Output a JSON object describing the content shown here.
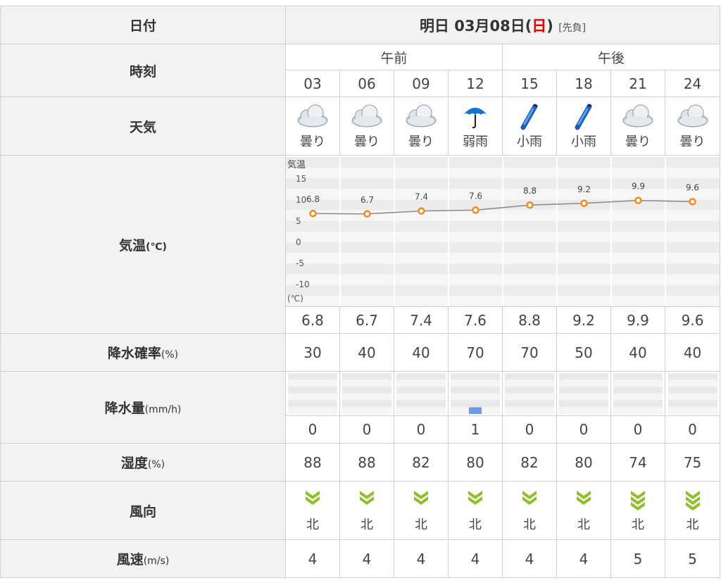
{
  "header": {
    "date_label": "日付",
    "date_prefix": "明日 03月08日(",
    "day_of_week": "日",
    "date_suffix": ")",
    "rokuyo": "[先負]"
  },
  "labels": {
    "time": "時刻",
    "weather": "天気",
    "temp": "気温",
    "temp_unit": "(℃)",
    "precip_prob": "降水確率",
    "precip_prob_unit": "(%)",
    "precip_amount": "降水量",
    "precip_amount_unit": "(mm/h)",
    "humidity": "湿度",
    "humidity_unit": "(%)",
    "wind_dir": "風向",
    "wind_speed": "風速",
    "wind_speed_unit": "(m/s)"
  },
  "periods": {
    "am": "午前",
    "pm": "午後"
  },
  "hours": [
    "03",
    "06",
    "09",
    "12",
    "15",
    "18",
    "21",
    "24"
  ],
  "weather": [
    {
      "icon": "cloud-icon",
      "label": "曇り"
    },
    {
      "icon": "cloud-icon",
      "label": "曇り"
    },
    {
      "icon": "cloud-icon",
      "label": "曇り"
    },
    {
      "icon": "umbrella-icon",
      "label": "弱雨"
    },
    {
      "icon": "light-rain-icon",
      "label": "小雨"
    },
    {
      "icon": "light-rain-icon",
      "label": "小雨"
    },
    {
      "icon": "cloud-icon",
      "label": "曇り"
    },
    {
      "icon": "cloud-icon",
      "label": "曇り"
    }
  ],
  "temperatures": [
    "6.8",
    "6.7",
    "7.4",
    "7.6",
    "8.8",
    "9.2",
    "9.9",
    "9.6"
  ],
  "precip_prob": [
    "30",
    "40",
    "40",
    "70",
    "70",
    "50",
    "40",
    "40"
  ],
  "precip_amount": [
    "0",
    "0",
    "0",
    "1",
    "0",
    "0",
    "0",
    "0"
  ],
  "humidity": [
    "88",
    "88",
    "82",
    "80",
    "82",
    "80",
    "74",
    "75"
  ],
  "wind_direction": [
    "北",
    "北",
    "北",
    "北",
    "北",
    "北",
    "北",
    "北"
  ],
  "wind_speed": [
    "4",
    "4",
    "4",
    "4",
    "4",
    "4",
    "5",
    "5"
  ],
  "chart_data": {
    "type": "line",
    "title": "気温",
    "ylabel": "(℃)",
    "categories": [
      "03",
      "06",
      "09",
      "12",
      "15",
      "18",
      "21",
      "24"
    ],
    "ylim": [
      -10,
      15
    ],
    "yticks": [
      "15",
      "10",
      "5",
      "0",
      "-5",
      "-10"
    ],
    "point_labels": [
      "6.8",
      "6.7",
      "7.4",
      "7.6",
      "8.8",
      "9.2",
      "9.9",
      "9.6"
    ],
    "series": [
      {
        "values": [
          6.8,
          6.7,
          7.4,
          7.6,
          8.8,
          9.2,
          9.9,
          9.6
        ]
      }
    ],
    "colors": {
      "line": "#888888",
      "marker": "#f08a1c",
      "band_a": "#ececec",
      "band_b": "#f6f6f6"
    }
  },
  "colors": {
    "label_bg": "#f2f2f2",
    "border": "#d0d0d0",
    "sunday_red": "#e60000",
    "precip_bar": "#6d9be8",
    "wind_arrow": "#8fbf2a"
  }
}
